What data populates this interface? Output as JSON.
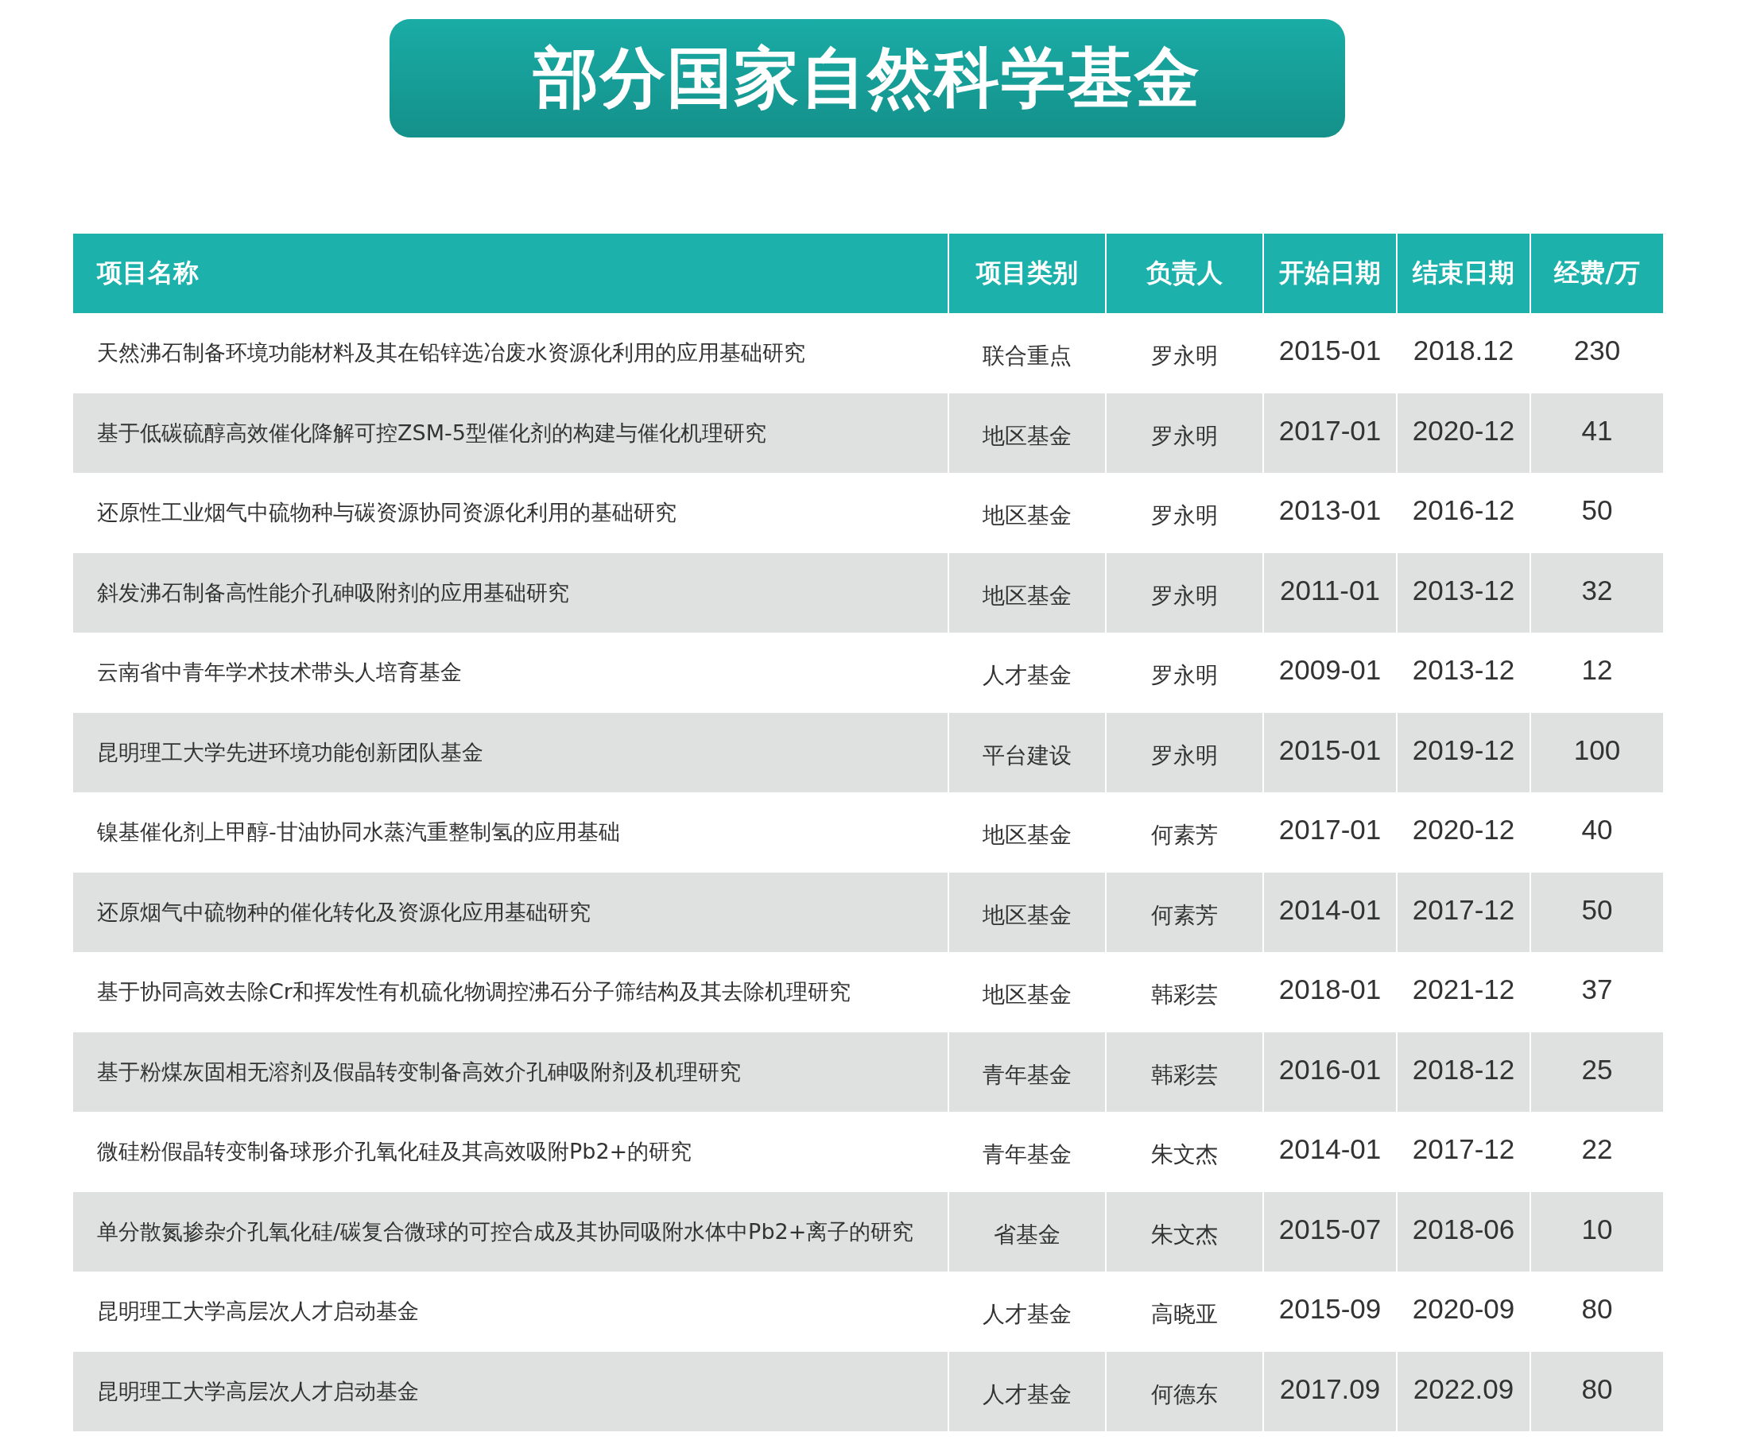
{
  "title": "部分国家自然科学基金",
  "table": {
    "columns": [
      "项目名称",
      "项目类别",
      "负责人",
      "开始日期",
      "结束日期",
      "经费/万"
    ],
    "rows": [
      [
        "天然沸石制备环境功能材料及其在铅锌选冶废水资源化利用的应用基础研究",
        "联合重点",
        "罗永明",
        "2015-01",
        "2018.12",
        "230"
      ],
      [
        "基于低碳硫醇高效催化降解可控ZSM-5型催化剂的构建与催化机理研究",
        "地区基金",
        "罗永明",
        "2017-01",
        "2020-12",
        "41"
      ],
      [
        "还原性工业烟气中硫物种与碳资源协同资源化利用的基础研究",
        "地区基金",
        "罗永明",
        "2013-01",
        "2016-12",
        "50"
      ],
      [
        "斜发沸石制备高性能介孔砷吸附剂的应用基础研究",
        "地区基金",
        "罗永明",
        "2011-01",
        "2013-12",
        "32"
      ],
      [
        "云南省中青年学术技术带头人培育基金",
        "人才基金",
        "罗永明",
        "2009-01",
        "2013-12",
        "12"
      ],
      [
        "昆明理工大学先进环境功能创新团队基金",
        "平台建设",
        "罗永明",
        "2015-01",
        "2019-12",
        "100"
      ],
      [
        "镍基催化剂上甲醇-甘油协同水蒸汽重整制氢的应用基础",
        "地区基金",
        "何素芳",
        "2017-01",
        "2020-12",
        "40"
      ],
      [
        "还原烟气中硫物种的催化转化及资源化应用基础研究",
        "地区基金",
        "何素芳",
        "2014-01",
        "2017-12",
        "50"
      ],
      [
        "基于协同高效去除Cr和挥发性有机硫化物调控沸石分子筛结构及其去除机理研究",
        "地区基金",
        "韩彩芸",
        "2018-01",
        "2021-12",
        "37"
      ],
      [
        "基于粉煤灰固相无溶剂及假晶转变制备高效介孔砷吸附剂及机理研究",
        "青年基金",
        "韩彩芸",
        "2016-01",
        "2018-12",
        "25"
      ],
      [
        "微硅粉假晶转变制备球形介孔氧化硅及其高效吸附Pb2+的研究",
        "青年基金",
        "朱文杰",
        "2014-01",
        "2017-12",
        "22"
      ],
      [
        "单分散氮掺杂介孔氧化硅/碳复合微球的可控合成及其协同吸附水体中Pb2+离子的研究",
        "省基金",
        "朱文杰",
        "2015-07",
        "2018-06",
        "10"
      ],
      [
        "昆明理工大学高层次人才启动基金",
        "人才基金",
        "高晓亚",
        "2015-09",
        "2020-09",
        "80"
      ],
      [
        "昆明理工大学高层次人才启动基金",
        "人才基金",
        "何德东",
        "2017.09",
        "2022.09",
        "80"
      ]
    ]
  }
}
